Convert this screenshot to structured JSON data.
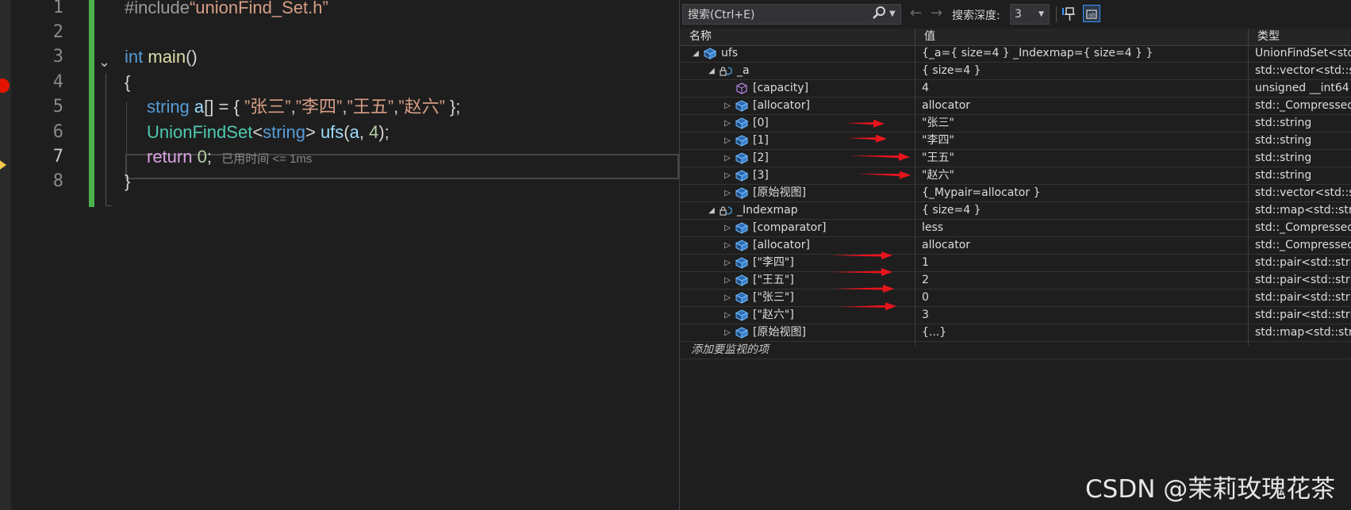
{
  "editor": {
    "line_numbers": [
      "1",
      "2",
      "3",
      "4",
      "5",
      "6",
      "7",
      "8"
    ],
    "line1": {
      "directive": "#include",
      "file": "“unionFind_Set.h”"
    },
    "line3": {
      "type": "int",
      "func": "main",
      "rest": "()"
    },
    "line4": "{",
    "line5": {
      "type": "string",
      "var": "a",
      "rest": "[] = { ",
      "s1": "”张三”",
      "c1": ",",
      "s2": "”李四”",
      "c2": ",",
      "s3": "”王五”",
      "c3": ",",
      "s4": "”赵六”",
      "end": " };"
    },
    "line6": {
      "type": "UnionFindSet",
      "lt": "<",
      "targ": "string",
      "gt": "> ",
      "func": "ufs",
      "open": "(",
      "arg1": "a",
      "comma": ", ",
      "arg2": "4",
      "close": ");"
    },
    "line7": {
      "kw": "return",
      "val": "0",
      "semi": ";",
      "hint": "已用时间 <= 1ms"
    },
    "line8": "}"
  },
  "watch": {
    "search_placeholder": "搜索(Ctrl+E)",
    "depth_label": "搜索深度:",
    "depth_value": "3",
    "columns": {
      "name": "名称",
      "value": "值",
      "type": "类型"
    },
    "rows": [
      {
        "name": "ufs",
        "value": "{_a={ size=4 } _Indexmap={ size=4 } }",
        "type": "UnionFindSet<std::...",
        "depth": 0,
        "toggle": "◢",
        "icon": "object"
      },
      {
        "name": "_a",
        "value": "{ size=4 }",
        "type": "std::vector<std::stri...",
        "depth": 1,
        "toggle": "◢",
        "icon": "private-field"
      },
      {
        "name": "[capacity]",
        "value": "4",
        "type": "unsigned __int64",
        "depth": 2,
        "toggle": "",
        "icon": "cube"
      },
      {
        "name": "[allocator]",
        "value": "allocator",
        "type": "std::_Compressed_...",
        "depth": 2,
        "toggle": "▷",
        "icon": "object"
      },
      {
        "name": "[0]",
        "value": "\"张三\"",
        "type": "std::string",
        "depth": 2,
        "toggle": "▷",
        "icon": "object"
      },
      {
        "name": "[1]",
        "value": "\"李四\"",
        "type": "std::string",
        "depth": 2,
        "toggle": "▷",
        "icon": "object"
      },
      {
        "name": "[2]",
        "value": "\"王五\"",
        "type": "std::string",
        "depth": 2,
        "toggle": "▷",
        "icon": "object"
      },
      {
        "name": "[3]",
        "value": "\"赵六\"",
        "type": "std::string",
        "depth": 2,
        "toggle": "▷",
        "icon": "object"
      },
      {
        "name": "[原始视图]",
        "value": "{_Mypair=allocator }",
        "type": "std::vector<std::stri...",
        "depth": 2,
        "toggle": "▷",
        "icon": "object"
      },
      {
        "name": "_Indexmap",
        "value": "{ size=4 }",
        "type": "std::map<std::strin...",
        "depth": 1,
        "toggle": "◢",
        "icon": "private-field"
      },
      {
        "name": "[comparator]",
        "value": "less",
        "type": "std::_Compressed_...",
        "depth": 2,
        "toggle": "▷",
        "icon": "object"
      },
      {
        "name": "[allocator]",
        "value": "allocator",
        "type": "std::_Compressed_...",
        "depth": 2,
        "toggle": "▷",
        "icon": "object"
      },
      {
        "name": "[\"李四\"]",
        "value": "1",
        "type": "std::pair<std::string",
        "depth": 2,
        "toggle": "▷",
        "icon": "object"
      },
      {
        "name": "[\"王五\"]",
        "value": "2",
        "type": "std::pair<std::string",
        "depth": 2,
        "toggle": "▷",
        "icon": "object"
      },
      {
        "name": "[\"张三\"]",
        "value": "0",
        "type": "std::pair<std::string",
        "depth": 2,
        "toggle": "▷",
        "icon": "object"
      },
      {
        "name": "[\"赵六\"]",
        "value": "3",
        "type": "std::pair<std::string",
        "depth": 2,
        "toggle": "▷",
        "icon": "object"
      },
      {
        "name": "[原始视图]",
        "value": "{...}",
        "type": "std::map<std::strin...",
        "depth": 2,
        "toggle": "▷",
        "icon": "object"
      }
    ],
    "add_item": "添加要监视的项"
  },
  "watermark": "CSDN @茉莉玫瑰花茶",
  "colors": {
    "breakpoint": "#e51400",
    "change_bar": "#4bb14b",
    "annotation_arrow": "#e8141c"
  }
}
